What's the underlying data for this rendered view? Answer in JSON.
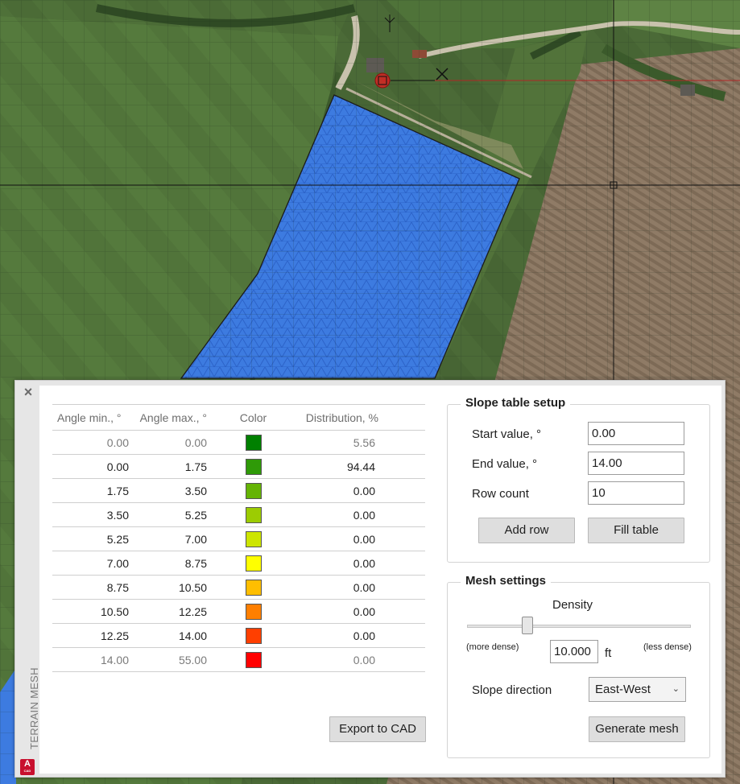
{
  "panel": {
    "close_glyph": "×",
    "side_title": "TERRAIN MESH",
    "app_icon_letter": "A",
    "app_icon_sub": "CAD"
  },
  "table": {
    "headers": [
      "Angle min., °",
      "Angle max., °",
      "Color",
      "Distribution, %"
    ],
    "rows": [
      {
        "min": "0.00",
        "max": "0.00",
        "color": "#008000",
        "dist": "5.56"
      },
      {
        "min": "0.00",
        "max": "1.75",
        "color": "#2f9a08",
        "dist": "94.44"
      },
      {
        "min": "1.75",
        "max": "3.50",
        "color": "#65b405",
        "dist": "0.00"
      },
      {
        "min": "3.50",
        "max": "5.25",
        "color": "#9ccc02",
        "dist": "0.00"
      },
      {
        "min": "5.25",
        "max": "7.00",
        "color": "#cde500",
        "dist": "0.00"
      },
      {
        "min": "7.00",
        "max": "8.75",
        "color": "#ffff00",
        "dist": "0.00"
      },
      {
        "min": "8.75",
        "max": "10.50",
        "color": "#ffbe00",
        "dist": "0.00"
      },
      {
        "min": "10.50",
        "max": "12.25",
        "color": "#ff7f00",
        "dist": "0.00"
      },
      {
        "min": "12.25",
        "max": "14.00",
        "color": "#ff3f00",
        "dist": "0.00"
      },
      {
        "min": "14.00",
        "max": "55.00",
        "color": "#ff0000",
        "dist": "0.00"
      }
    ],
    "export_label": "Export to CAD"
  },
  "slope_setup": {
    "title": "Slope table setup",
    "start_label": "Start value, °",
    "start_value": "0.00",
    "end_label": "End value, °",
    "end_value": "14.00",
    "rows_label": "Row count",
    "rows_value": "10",
    "add_row_label": "Add row",
    "fill_table_label": "Fill table"
  },
  "mesh": {
    "title": "Mesh settings",
    "density_label": "Density",
    "density_slider_fraction": 0.27,
    "more_dense_label": "(more dense)",
    "less_dense_label": "(less dense)",
    "density_value": "10.000",
    "unit": "ft",
    "direction_label": "Slope direction",
    "direction_value": "East-West",
    "generate_label": "Generate mesh"
  }
}
